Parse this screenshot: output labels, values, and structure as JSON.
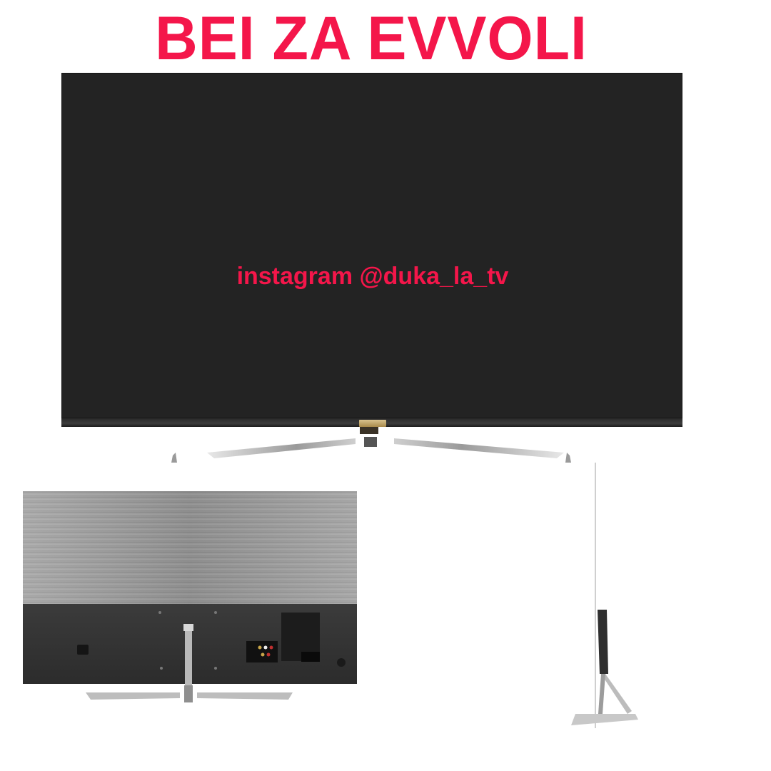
{
  "headline": "BEI ZA EVVOLI",
  "screen_text": "instagram @duka_la_tv",
  "colors": {
    "accent": "#f4164a",
    "screen": "#232323",
    "bezel": "#2a2a2a",
    "logo": "#c8ad6e",
    "back_panel": "#9a9a9a",
    "back_lower": "#333333"
  },
  "images": {
    "front": "tv-front-view",
    "back": "tv-back-view",
    "side": "tv-side-view"
  }
}
